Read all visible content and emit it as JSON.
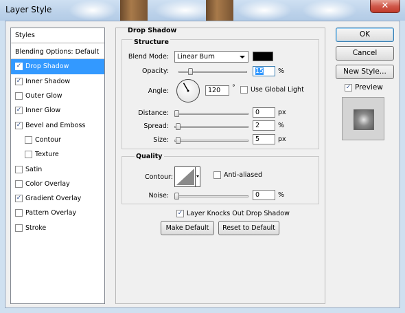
{
  "window": {
    "title": "Layer Style",
    "close_symbol": "✕"
  },
  "styles_panel": {
    "header": "Styles",
    "items": [
      {
        "label": "Blending Options: Default",
        "has_checkbox": false,
        "checked": false,
        "indent": false,
        "selected": false
      },
      {
        "label": "Drop Shadow",
        "has_checkbox": true,
        "checked": true,
        "indent": false,
        "selected": true
      },
      {
        "label": "Inner Shadow",
        "has_checkbox": true,
        "checked": true,
        "indent": false,
        "selected": false
      },
      {
        "label": "Outer Glow",
        "has_checkbox": true,
        "checked": false,
        "indent": false,
        "selected": false
      },
      {
        "label": "Inner Glow",
        "has_checkbox": true,
        "checked": true,
        "indent": false,
        "selected": false
      },
      {
        "label": "Bevel and Emboss",
        "has_checkbox": true,
        "checked": true,
        "indent": false,
        "selected": false
      },
      {
        "label": "Contour",
        "has_checkbox": true,
        "checked": false,
        "indent": true,
        "selected": false
      },
      {
        "label": "Texture",
        "has_checkbox": true,
        "checked": false,
        "indent": true,
        "selected": false
      },
      {
        "label": "Satin",
        "has_checkbox": true,
        "checked": false,
        "indent": false,
        "selected": false
      },
      {
        "label": "Color Overlay",
        "has_checkbox": true,
        "checked": false,
        "indent": false,
        "selected": false
      },
      {
        "label": "Gradient Overlay",
        "has_checkbox": true,
        "checked": true,
        "indent": false,
        "selected": false
      },
      {
        "label": "Pattern Overlay",
        "has_checkbox": true,
        "checked": false,
        "indent": false,
        "selected": false
      },
      {
        "label": "Stroke",
        "has_checkbox": true,
        "checked": false,
        "indent": false,
        "selected": false
      }
    ]
  },
  "drop_shadow": {
    "title": "Drop Shadow",
    "structure": {
      "title": "Structure",
      "blend_mode_label": "Blend Mode:",
      "blend_mode_value": "Linear Burn",
      "shadow_color": "#000000",
      "opacity_label": "Opacity:",
      "opacity_value": "15",
      "opacity_unit": "%",
      "opacity_level": 0.15,
      "angle_label": "Angle:",
      "angle_value": "120",
      "angle_unit": "°",
      "angle_degrees": 120,
      "use_global_light_label": "Use Global Light",
      "use_global_light_checked": false,
      "distance_label": "Distance:",
      "distance_value": "0",
      "distance_unit": "px",
      "distance_level": 0.0,
      "spread_label": "Spread:",
      "spread_value": "2",
      "spread_unit": "%",
      "spread_level": 0.02,
      "size_label": "Size:",
      "size_value": "5",
      "size_unit": "px",
      "size_level": 0.02
    },
    "quality": {
      "title": "Quality",
      "contour_label": "Contour:",
      "anti_aliased_label": "Anti-aliased",
      "anti_aliased_checked": false,
      "noise_label": "Noise:",
      "noise_value": "0",
      "noise_unit": "%",
      "noise_level": 0.0
    },
    "layer_knocks_out_label": "Layer Knocks Out Drop Shadow",
    "layer_knocks_out_checked": true,
    "make_default_label": "Make Default",
    "reset_default_label": "Reset to Default"
  },
  "buttons": {
    "ok": "OK",
    "cancel": "Cancel",
    "new_style": "New Style...",
    "preview_label": "Preview",
    "preview_checked": true
  }
}
